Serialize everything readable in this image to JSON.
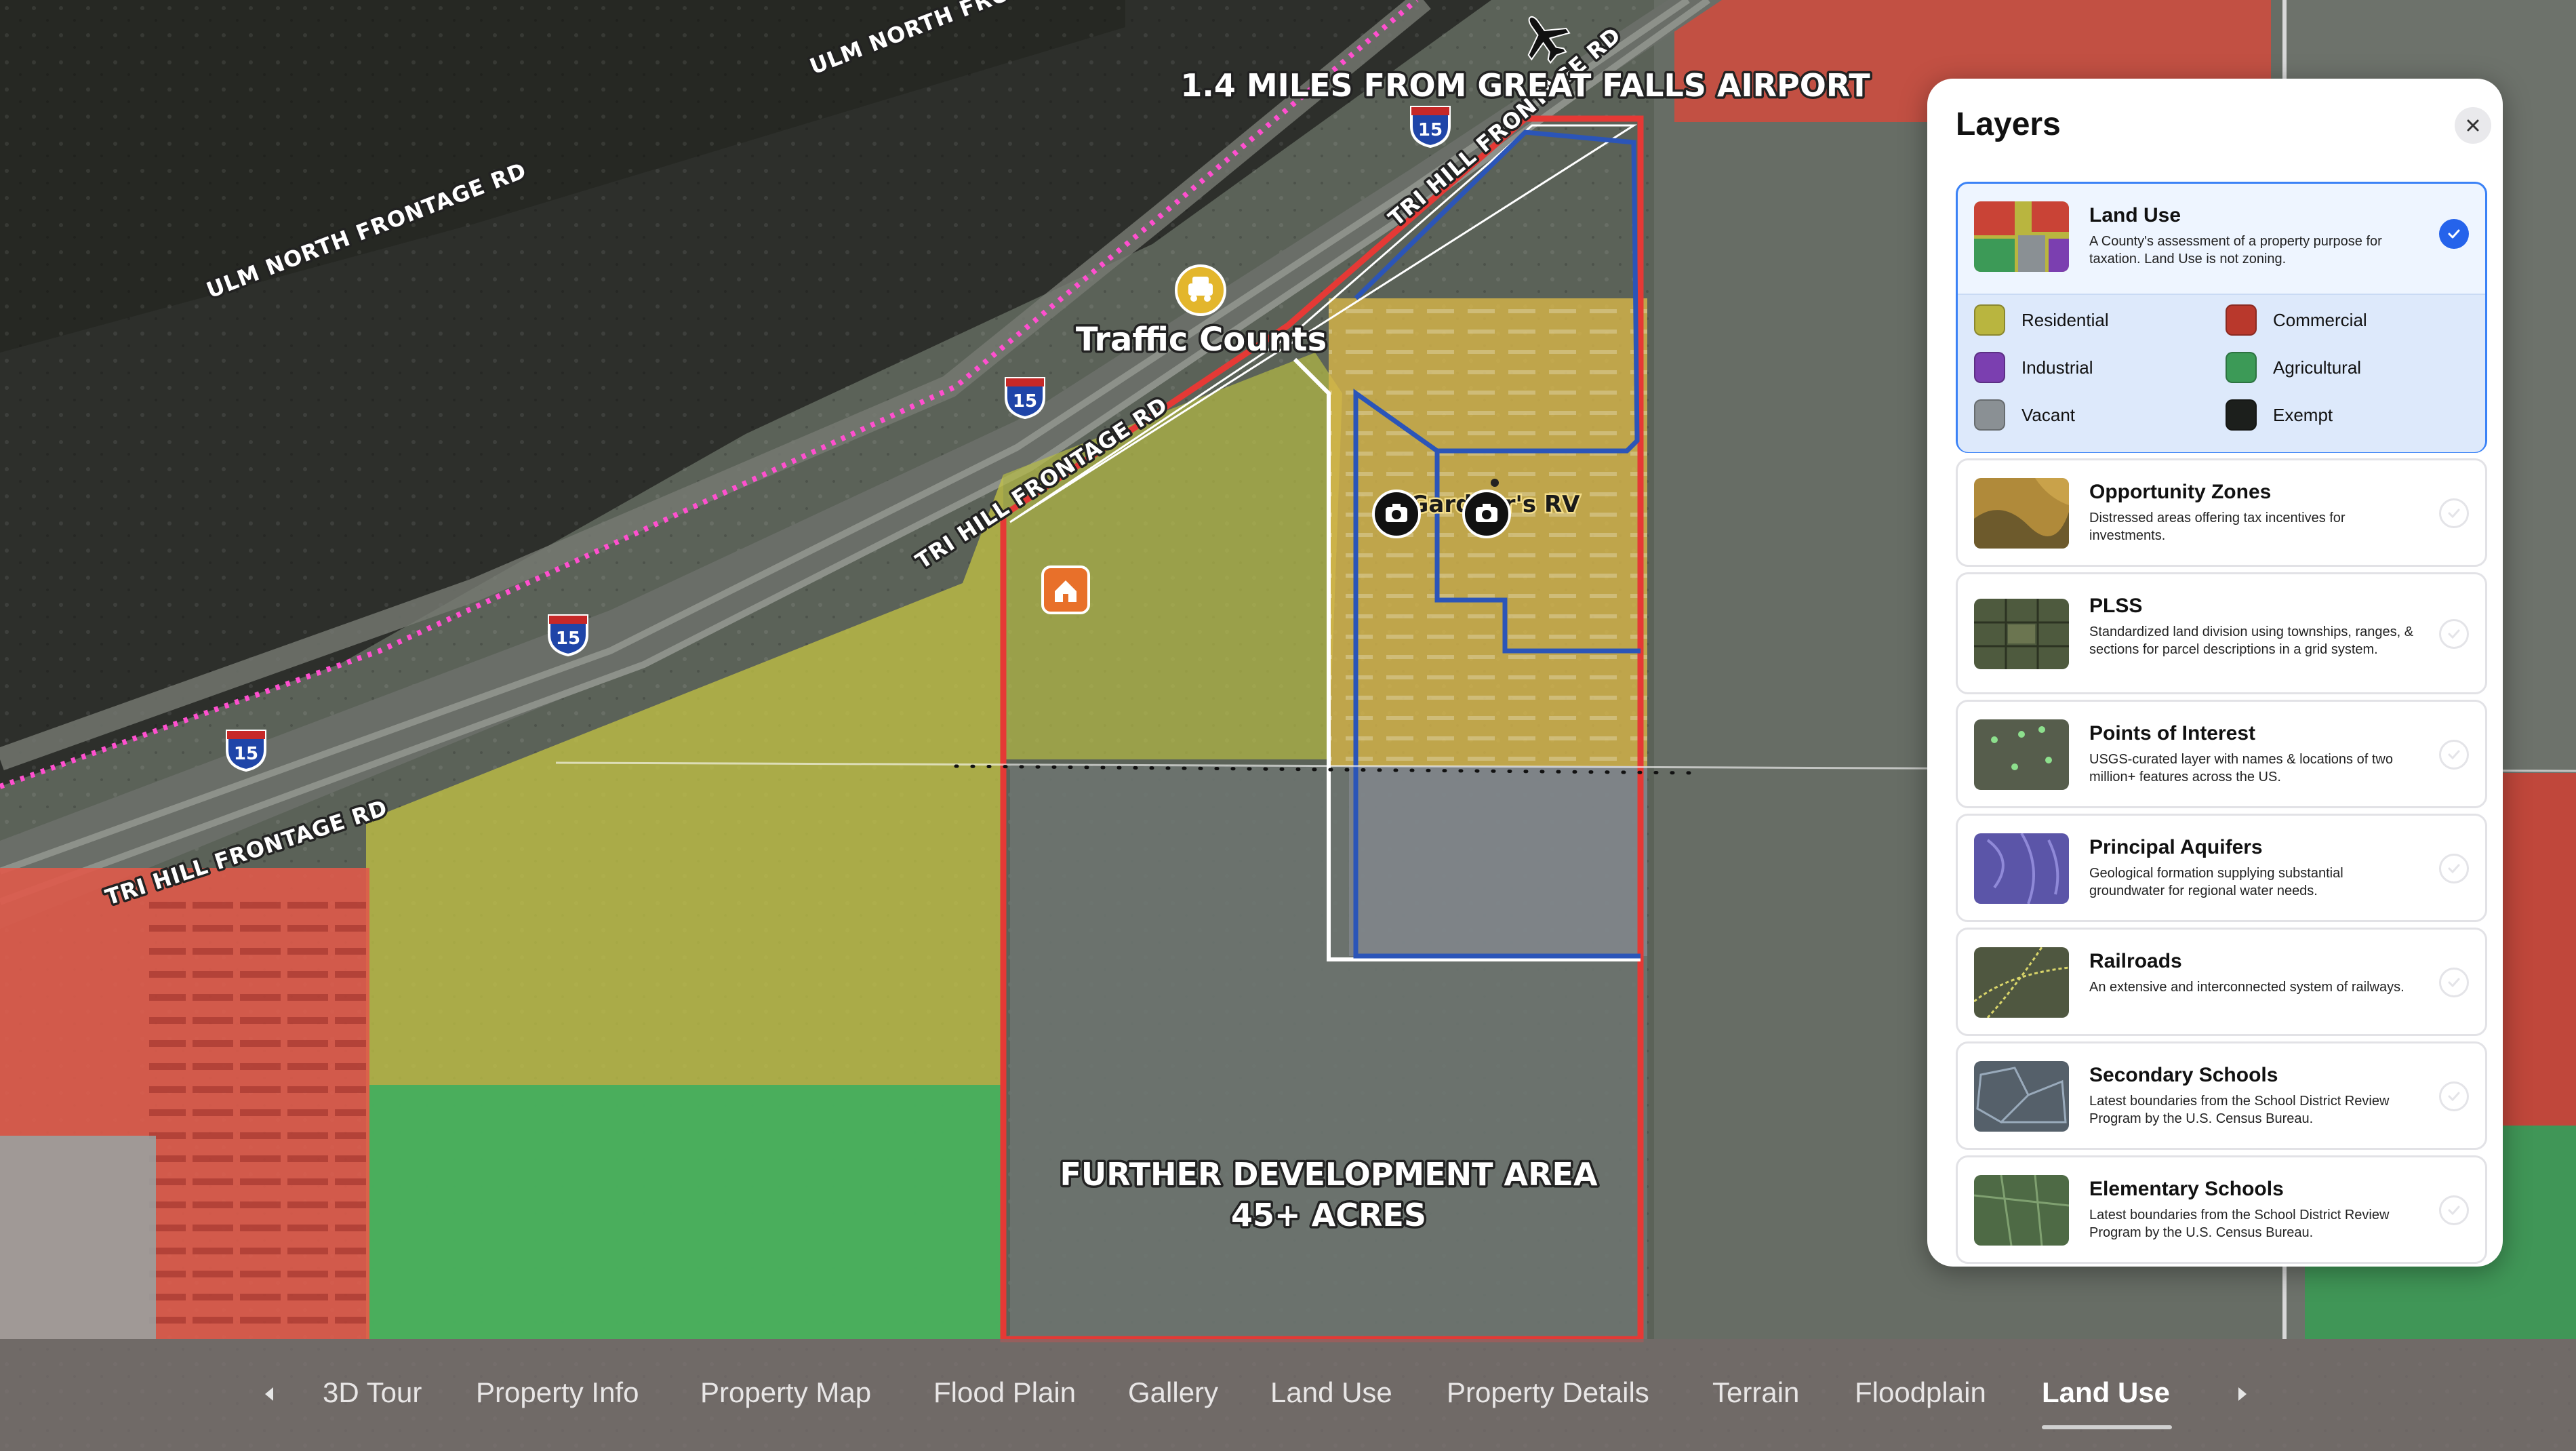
{
  "map": {
    "callouts": {
      "airport": "1.4 MILES FROM GREAT FALLS AIRPORT",
      "traffic": "Traffic Counts",
      "business": "Gardner's RV",
      "development_line1": "FURTHER DEVELOPMENT AREA",
      "development_line2": "45+ ACRES"
    },
    "roads": {
      "ulm_top": "ULM NORTH FRONTAGE RD",
      "ulm_left": "ULM NORTH FRONTAGE RD",
      "tri_hill_top": "TRI HILL FRONTAGE RD",
      "tri_hill_mid": "TRI HILL FRONTAGE RD",
      "tri_hill_bottom": "TRI HILL FRONTAGE RD"
    },
    "highway_shield": "15",
    "colors": {
      "commercial": "#e05a4a",
      "residential": "#c8c74a",
      "agricultural": "#3fae5e",
      "parcel_outline": "#e53935",
      "inner_outline": "#2b55b8",
      "boundary_dotted": "#ff4fcf"
    }
  },
  "layers": {
    "title": "Layers",
    "close_icon": "close-icon",
    "items": [
      {
        "name": "Land Use",
        "description": "A County's assessment of a property purpose for taxation. Land Use is not zoning.",
        "selected": true
      },
      {
        "name": "Opportunity Zones",
        "description": "Distressed areas offering tax incentives for investments.",
        "selected": false
      },
      {
        "name": "PLSS",
        "description": "Standardized land division using townships, ranges, & sections for parcel descriptions in a grid system.",
        "selected": false
      },
      {
        "name": "Points of Interest",
        "description": "USGS-curated layer with names & locations of two million+ features across the US.",
        "selected": false
      },
      {
        "name": "Principal Aquifers",
        "description": "Geological formation supplying substantial groundwater for regional water needs.",
        "selected": false
      },
      {
        "name": "Railroads",
        "description": "An extensive and interconnected system of railways.",
        "selected": false
      },
      {
        "name": "Secondary Schools",
        "description": "Latest boundaries from the School District Review Program by the U.S. Census Bureau.",
        "selected": false
      },
      {
        "name": "Elementary Schools",
        "description": "Latest boundaries from the School District Review Program by the U.S. Census Bureau.",
        "selected": false
      }
    ],
    "legend": [
      {
        "label": "Residential",
        "color": "#b9b53f"
      },
      {
        "label": "Commercial",
        "color": "#b9382c"
      },
      {
        "label": "Industrial",
        "color": "#7b3fb0"
      },
      {
        "label": "Agricultural",
        "color": "#3c9a57"
      },
      {
        "label": "Vacant",
        "color": "#8a9094"
      },
      {
        "label": "Exempt",
        "color": "#1c1f1c"
      }
    ]
  },
  "nav": {
    "items": [
      "3D Tour",
      "Property Info",
      "Property Map",
      "Flood Plain",
      "Gallery",
      "Land Use",
      "Property Details",
      "Terrain",
      "Floodplain",
      "Land Use"
    ],
    "active_index": 9
  }
}
